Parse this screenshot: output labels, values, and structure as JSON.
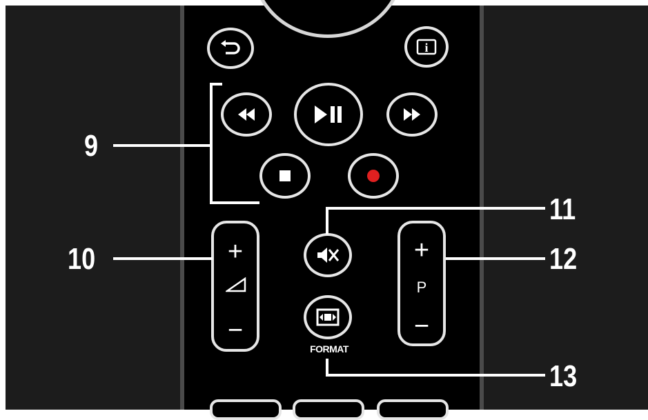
{
  "buttons": {
    "back": "back-arrow",
    "info": "i",
    "rewind": "rewind",
    "play_pause": "play-pause",
    "fast_forward": "fast-forward",
    "stop": "stop",
    "record": "record",
    "mute": "mute",
    "format": "format"
  },
  "volume_rocker": {
    "plus": "+",
    "minus": "−"
  },
  "program_rocker": {
    "plus": "+",
    "label": "P",
    "minus": "−"
  },
  "format_label": "FORMAT",
  "callouts": [
    "9",
    "10",
    "11",
    "12",
    "13"
  ],
  "colors": {
    "background": "#1c1c1c",
    "remote": "#000000",
    "button_outline": "#e6e6e6",
    "record": "#e02020",
    "text": "#ffffff"
  }
}
